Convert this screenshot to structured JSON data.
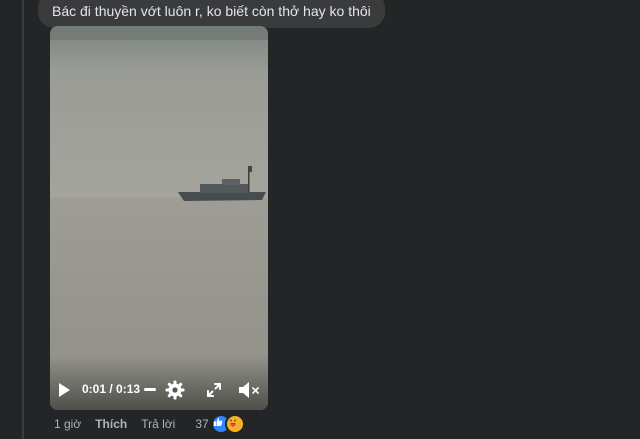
{
  "comment": {
    "text": "Bác đi thuyền vớt luôn r, ko biết còn thở hay ko thôi"
  },
  "video": {
    "current_time": "0:01",
    "duration": "0:13",
    "time_separator": " / ",
    "progress_fraction": 0.077
  },
  "actions": {
    "timestamp": "1 giờ",
    "like_label": "Thích",
    "reply_label": "Trả lời",
    "reaction_count": "37"
  },
  "reactions": [
    "like-icon",
    "care-icon"
  ],
  "colors": {
    "background": "#242526",
    "bubble": "#3a3b3c",
    "text_primary": "#e4e6eb",
    "text_secondary": "#b0b3b8",
    "like_blue": "#2d88ff",
    "care_yellow": "#f7b125"
  }
}
